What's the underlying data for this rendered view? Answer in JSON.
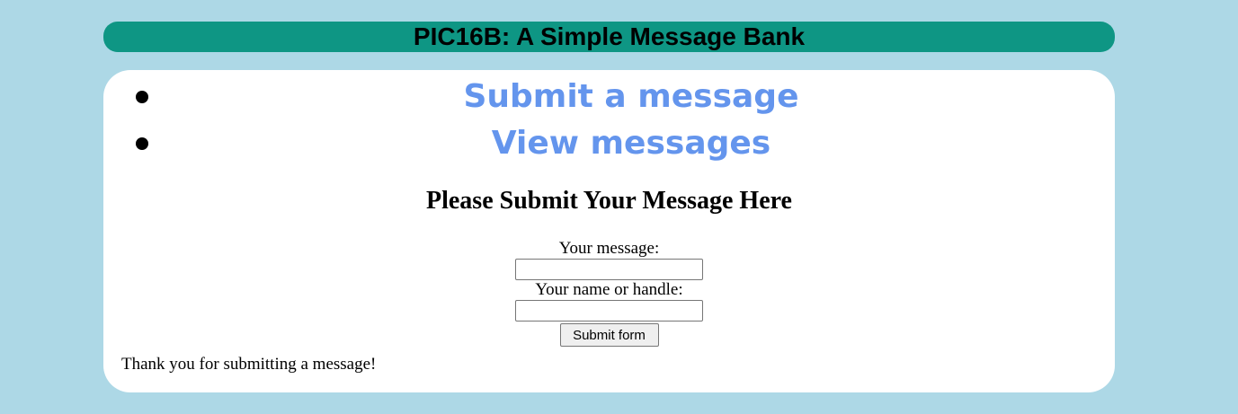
{
  "header": {
    "title": "PIC16B: A Simple Message Bank"
  },
  "nav": {
    "items": [
      {
        "label": "Submit a message"
      },
      {
        "label": "View messages"
      }
    ]
  },
  "form": {
    "title": "Please Submit Your Message Here",
    "message_label": "Your message:",
    "message_value": "",
    "name_label": "Your name or handle:",
    "name_value": "",
    "submit_label": "Submit form"
  },
  "status": {
    "thanks": "Thank you for submitting a message!"
  },
  "colors": {
    "page_background": "#add8e6",
    "header_background": "#0e9684",
    "panel_background": "#ffffff",
    "link_color": "#6495ed"
  }
}
